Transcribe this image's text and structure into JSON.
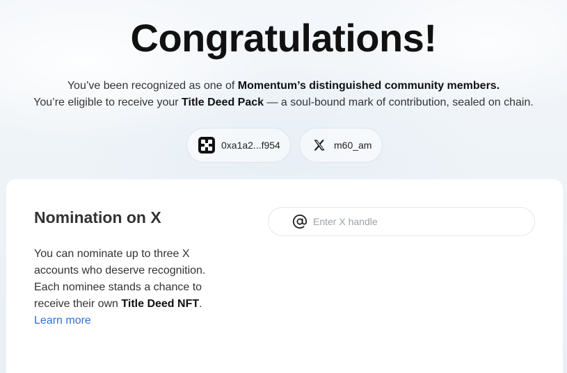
{
  "hero": {
    "title": "Congratulations!",
    "line1_pre": "You’ve been recognized as one of ",
    "line1_bold": "Momentum’s distinguished community members.",
    "line2_pre": "You’re eligible to receive your ",
    "line2_bold": "Title Deed Pack",
    "line2_post": " — a soul-bound mark of contribution, sealed on chain."
  },
  "chips": {
    "wallet_address": "0xa1a2...f954",
    "x_handle": "m60_am"
  },
  "nomination": {
    "title": "Nomination on X",
    "desc_line1": "You can nominate up to three X accounts who deserve recognition.",
    "desc_line2_pre": "Each nominee stands a chance to receive their own ",
    "desc_line2_bold": "Title Deed NFT",
    "desc_line2_post": ".",
    "learn_more": "Learn more",
    "input_placeholder": "Enter X handle"
  }
}
